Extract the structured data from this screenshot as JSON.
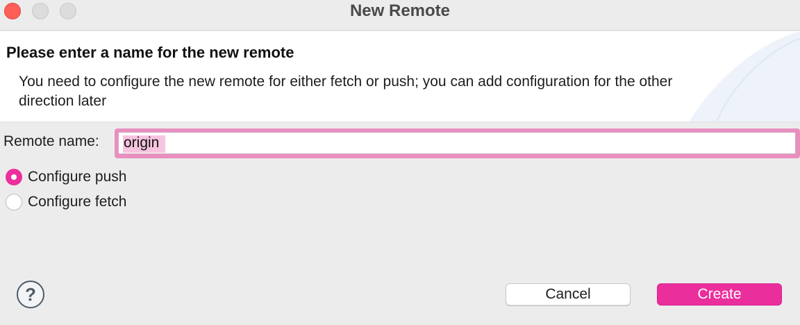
{
  "window": {
    "title": "New Remote"
  },
  "banner": {
    "title": "Please enter a name for the new remote",
    "description": "You need to configure the new remote for either fetch or push; you can add configuration for the other direction later"
  },
  "form": {
    "remote_name_label": "Remote name:",
    "remote_name_value": "origin",
    "options": [
      {
        "label": "Configure push",
        "selected": true
      },
      {
        "label": "Configure fetch",
        "selected": false
      }
    ]
  },
  "buttons": {
    "help_glyph": "?",
    "cancel_label": "Cancel",
    "create_label": "Create"
  },
  "colors": {
    "accent": "#ea2f9d",
    "focus_ring": "#e98fbf",
    "close": "#ff5f57"
  },
  "icons": {
    "help": "help-icon"
  }
}
